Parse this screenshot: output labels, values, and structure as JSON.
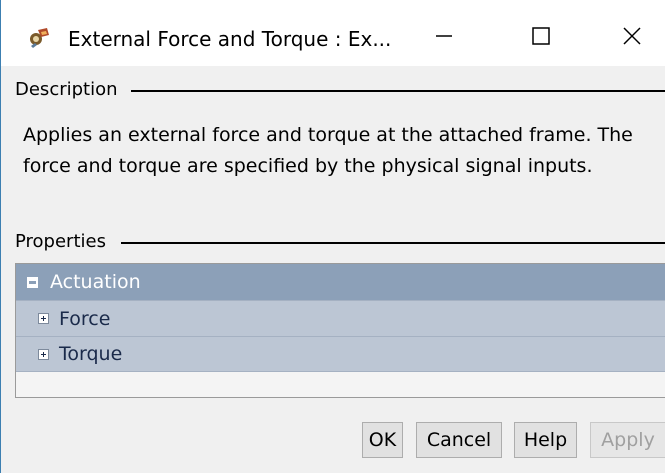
{
  "window": {
    "title": "External Force and Torque : Ex..."
  },
  "titlebar_icons": {
    "app": "simscape-block-icon",
    "minimize": "minimize-icon",
    "maximize": "maximize-icon",
    "close": "close-icon"
  },
  "description": {
    "label": "Description",
    "text": "Applies an external force and torque at the attached frame. The force and torque are specified by the physical signal inputs."
  },
  "properties": {
    "label": "Properties",
    "group": {
      "label": "Actuation",
      "expanded": true,
      "items": [
        {
          "label": "Force",
          "expanded": false
        },
        {
          "label": "Torque",
          "expanded": false
        }
      ]
    }
  },
  "buttons": {
    "ok": "OK",
    "cancel": "Cancel",
    "help": "Help",
    "apply": "Apply",
    "apply_enabled": false
  },
  "colors": {
    "group_header": "#8ca0b8",
    "child_row": "#bcc6d4",
    "window_border": "#3c7fb1"
  }
}
